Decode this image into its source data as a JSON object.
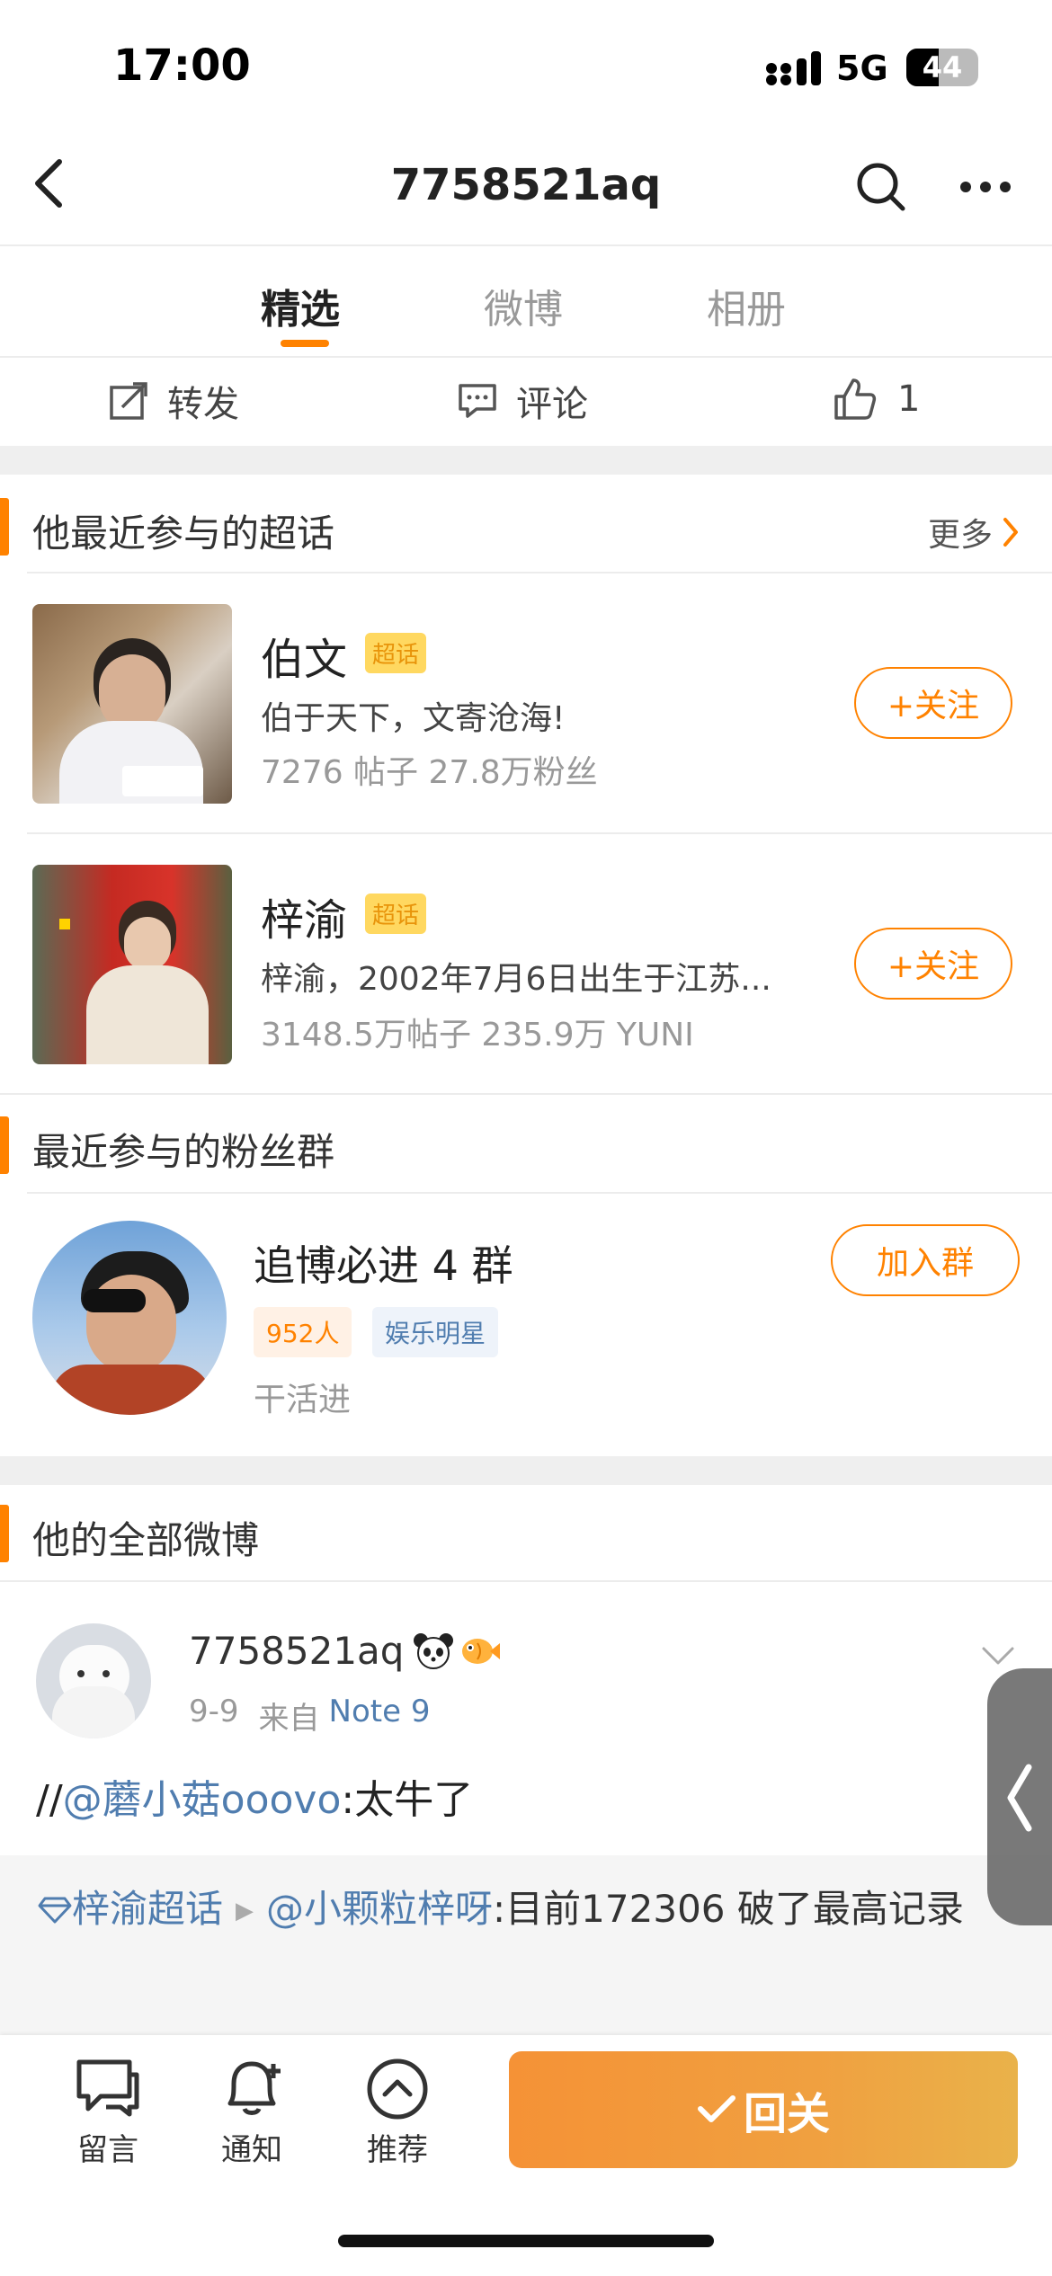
{
  "status": {
    "time": "17:00",
    "network": "5G",
    "battery": "44"
  },
  "nav": {
    "title": "7758521aq"
  },
  "tabs": [
    {
      "label": "精选",
      "active": true
    },
    {
      "label": "微博",
      "active": false
    },
    {
      "label": "相册",
      "active": false
    }
  ],
  "actions": {
    "repost": "转发",
    "comment": "评论",
    "like_count": "1"
  },
  "supertopics": {
    "title": "他最近参与的超话",
    "more": "更多",
    "items": [
      {
        "name": "伯文",
        "badge": "超话",
        "desc": "伯于天下，文寄沧海!",
        "stats": "7276 帖子 27.8万粉丝",
        "button": "+关注"
      },
      {
        "name": "梓渝",
        "badge": "超话",
        "desc": "梓渝，2002年7月6日出生于江苏...",
        "stats": "3148.5万帖子 235.9万 YUNI",
        "button": "+关注"
      }
    ]
  },
  "fangroup": {
    "title": "最近参与的粉丝群",
    "name": "追博必进 4 群",
    "count_tag": "952人",
    "category_tag": "娱乐明星",
    "desc": "干活进",
    "button": "加入群"
  },
  "weibo": {
    "title": "他的全部微博",
    "author": "7758521aq",
    "meta_date": "9-9",
    "meta_from": "来自",
    "meta_device": "Note 9",
    "text_prefix": "//",
    "mention": "@蘑小菇ooovo",
    "text_suffix": ":太牛了",
    "repost_topic": "梓渝超话",
    "repost_mention": "@小颗粒梓呀",
    "repost_text": ":目前172306 破了最高记录"
  },
  "bottom": {
    "message": "留言",
    "notify": "通知",
    "recommend": "推荐",
    "follow_back": "回关"
  },
  "colors": {
    "accent": "#ff8200",
    "link": "#507daf"
  }
}
